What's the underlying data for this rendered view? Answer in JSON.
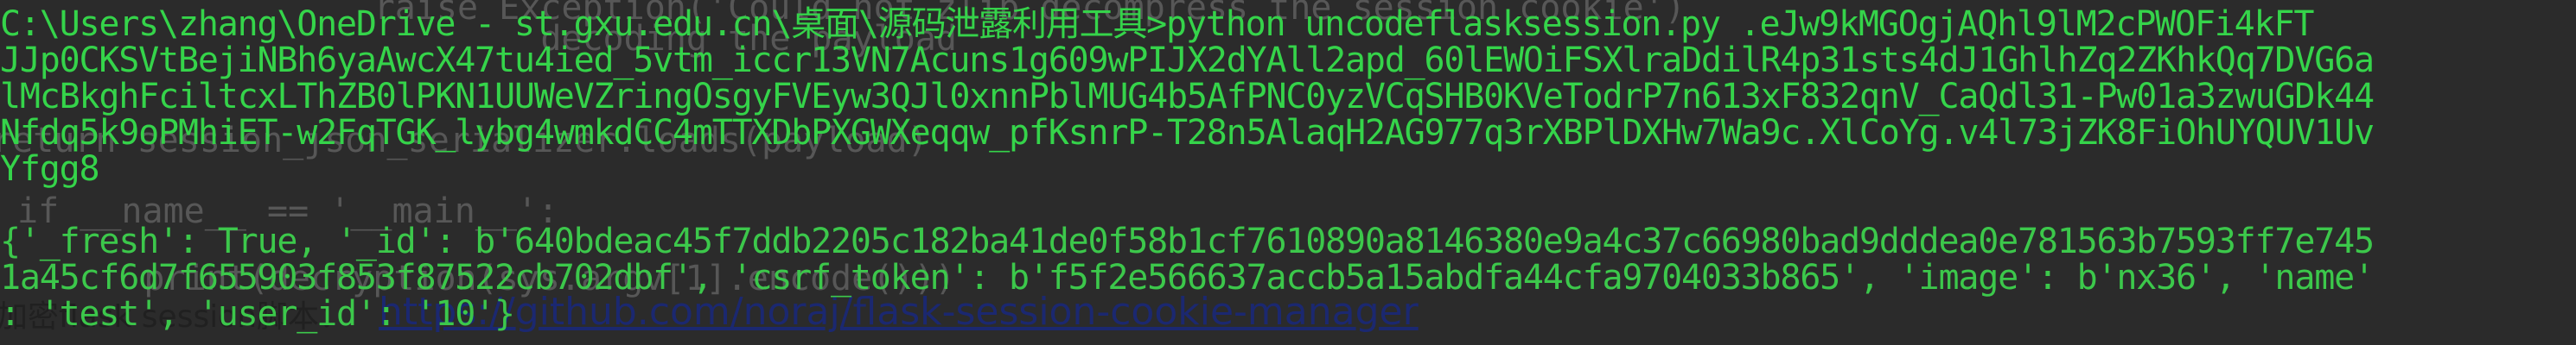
{
  "editor": {
    "lines": [
      "        raise Exception('Could not zlib decompress the session cookie')",
      "                decoding the payload",
      "return session_json_serializer.loads(payload)",
      "if __name__ == '__main__':",
      "    print(decryption(sys.argv[1].encode()))"
    ],
    "blog_label": "加密flask session脚本：",
    "blog_link": "https://github.com/noraj/flask-session-cookie-manager"
  },
  "terminal": {
    "prompt": "C:\\Users\\zhang\\OneDrive - st.gxu.edu.cn\\桌面\\源码泄露利用工具>",
    "command": "python uncodeflasksession.py .eJw9kMGOgjAQhl9lM2cPWOFi4kFT",
    "command_cont": [
      "JJp0CKSVtBejiNBh6yaAwcX47tu4ied_5vtm_iccr13VN7Acuns1g609wPIJX2dYAll2apd_60lEWOiFSXlraDdilR4p31sts4dJ1GhlhZq2ZKhkQq7DVG6a",
      "lMcBkghFciltcxLThZB0lPKN1UUWeVZringOsgyFVEyw3QJl0xnnPblMUG4b5AfPNC0yzVCqSHB0KVeTodrP7n613xF832qnV_CaQdl31-Pw01a3zwuGDk44",
      "Nfdq5k9oPMhiET-w2FqTGK_lybg4wmkdCC4mTTXDbPXGWXeqqw_pfKsnrP-T28n5AlaqH2AG977q3rXBPlDXHw7Wa9c.XlCoYg.v4l73jZK8FiOhUYQUV1Uv",
      "Yfgg8"
    ],
    "output": [
      "{'_fresh': True, '_id': b'640bdeac45f7ddb2205c182ba41de0f58b1cf7610890a8146380e9a4c37c66980bad9dddea0e781563b7593ff7e745",
      "1a45cf6d7f655903f853f87522cb702dbf', 'csrf_token': b'f5f2e566637accb5a15abdfa44cfa9704033b865', 'image': b'nx36', 'name'",
      ": 'test', 'user_id': '10'}"
    ]
  }
}
